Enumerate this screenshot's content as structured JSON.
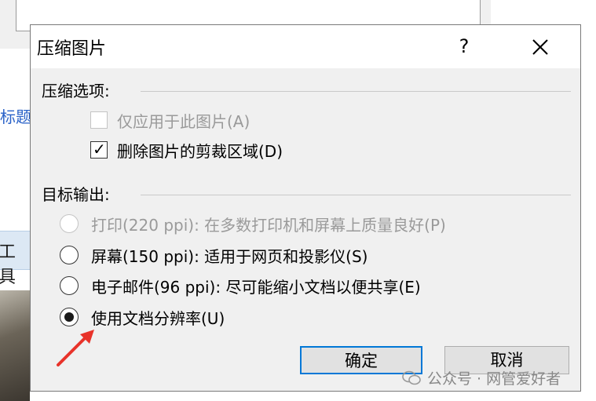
{
  "background": {
    "partial_label": "标题",
    "partial_tools": "工具"
  },
  "dialog": {
    "title": "压缩图片",
    "help_label": "?",
    "close_label": "✕",
    "compress_group": {
      "title": "压缩选项:",
      "options": [
        {
          "label": "仅应用于此图片(A)",
          "checked": false,
          "disabled": true
        },
        {
          "label": "删除图片的剪裁区域(D)",
          "checked": true,
          "disabled": false
        }
      ]
    },
    "output_group": {
      "title": "目标输出:",
      "options": [
        {
          "label": "打印(220 ppi): 在多数打印机和屏幕上质量良好(P)",
          "selected": false,
          "disabled": true
        },
        {
          "label": "屏幕(150 ppi): 适用于网页和投影仪(S)",
          "selected": false,
          "disabled": false
        },
        {
          "label": "电子邮件(96 ppi): 尽可能缩小文档以便共享(E)",
          "selected": false,
          "disabled": false
        },
        {
          "label": "使用文档分辨率(U)",
          "selected": true,
          "disabled": false
        }
      ]
    },
    "ok_label": "确定",
    "cancel_label": "取消"
  },
  "watermark": {
    "text": "公众号 · 网管爱好者"
  },
  "colors": {
    "accent": "#0078d7",
    "arrow": "#e8332a",
    "dialog_bg": "#f0f0f0"
  }
}
